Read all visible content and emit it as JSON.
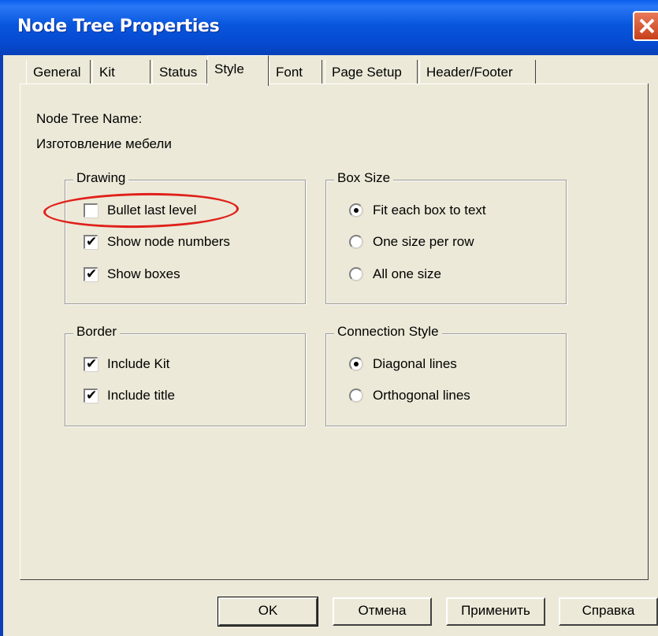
{
  "window": {
    "title": "Node Tree Properties",
    "accent_color": "#0856DD",
    "close_icon": "close-icon"
  },
  "tabs": [
    {
      "label": "General",
      "active": false
    },
    {
      "label": "Kit",
      "active": false
    },
    {
      "label": "Status",
      "active": false
    },
    {
      "label": "Style",
      "active": true
    },
    {
      "label": "Font",
      "active": false
    },
    {
      "label": "Page Setup",
      "active": false
    },
    {
      "label": "Header/Footer",
      "active": false
    }
  ],
  "style_tab": {
    "tree_name_label": "Node Tree Name:",
    "tree_name_value": "Изготовление мебели",
    "drawing": {
      "legend": "Drawing",
      "options": [
        {
          "label": "Bullet last level",
          "checked": false
        },
        {
          "label": "Show node numbers",
          "checked": true
        },
        {
          "label": "Show boxes",
          "checked": true
        }
      ]
    },
    "box_size": {
      "legend": "Box Size",
      "options": [
        {
          "label": "Fit each box to text",
          "selected": true
        },
        {
          "label": "One size per row",
          "selected": false
        },
        {
          "label": "All one size",
          "selected": false
        }
      ]
    },
    "border": {
      "legend": "Border",
      "options": [
        {
          "label": "Include Kit",
          "checked": true
        },
        {
          "label": "Include title",
          "checked": true
        }
      ]
    },
    "connection_style": {
      "legend": "Connection Style",
      "options": [
        {
          "label": "Diagonal lines",
          "selected": true
        },
        {
          "label": "Orthogonal lines",
          "selected": false
        }
      ]
    }
  },
  "buttons": {
    "ok": "OK",
    "cancel": "Отмена",
    "apply": "Применить",
    "help": "Справка"
  },
  "annotation_color": "#E0201A",
  "check_glyph": "✔"
}
